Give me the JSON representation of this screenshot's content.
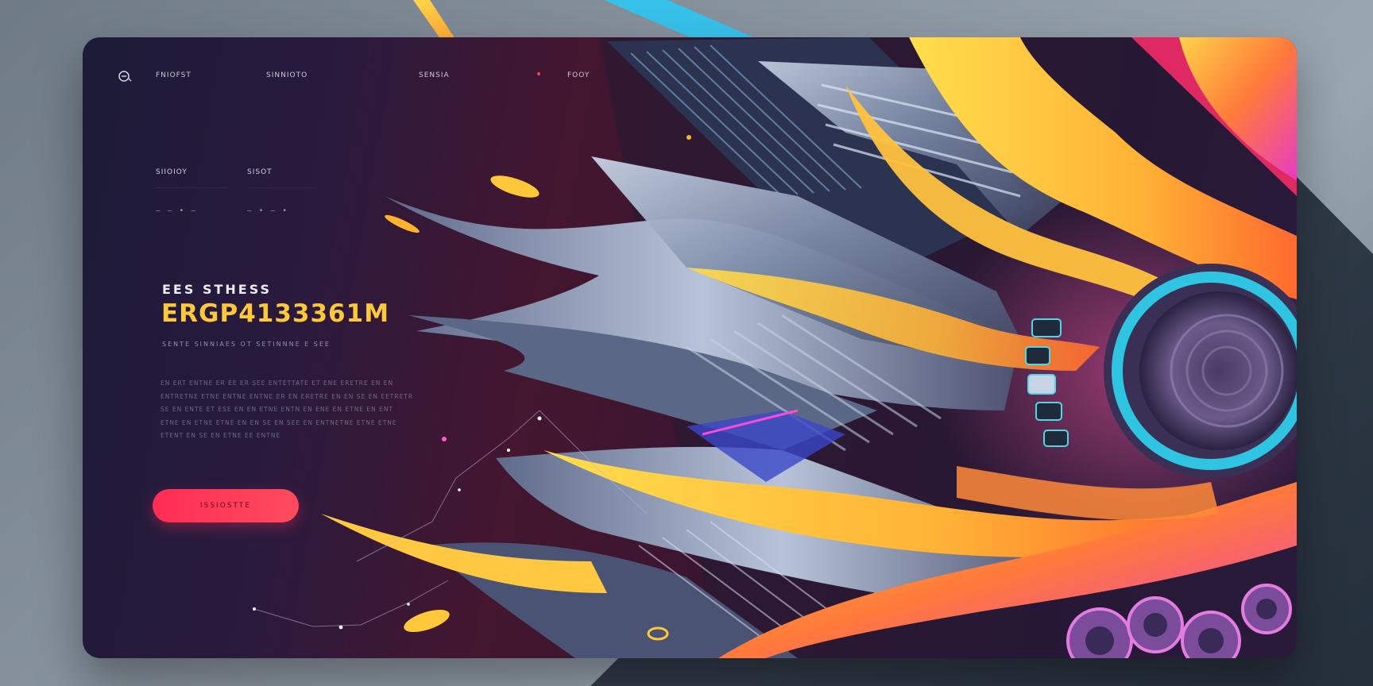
{
  "nav": {
    "links": [
      "FNIOFST",
      "SINNIOTO",
      "SENSIA",
      "FOOY"
    ]
  },
  "stats": [
    {
      "label": "SIIOIOY",
      "value": "– – • –"
    },
    {
      "label": "SISOT",
      "value": "– • – •"
    }
  ],
  "hero": {
    "eyebrow": "EES STHESS",
    "headline": "ERGP4133361M",
    "subtitle": "SENTE SINNIAES OT SETINNNE E SEE",
    "body": "EN ERT ENTNE ER EE ER SEE ENTETTATE ET ENE ERETRE EN EN ENTRETNE ETNE ENTNE ENTNE ER EN ERETRE EN EN SE EN EETRETR SE EN ENTE ET ESE EN EN ETNE ENTN EN ENE EN ETNE EN ENT ETNE EN ETNE ETNE EN EN SE EN SEE EN ENTNETNE ETNE ETNE ETENT EN SE EN ETNE EE ENTNE",
    "cta_label": "ISSIOSTTE"
  },
  "colors": {
    "accent_yellow": "#ffc73a",
    "cta_red": "#ff2d55",
    "cyan": "#2fc6f2",
    "magenta": "#ff3ad0"
  },
  "icons": [
    "logo-icon"
  ]
}
